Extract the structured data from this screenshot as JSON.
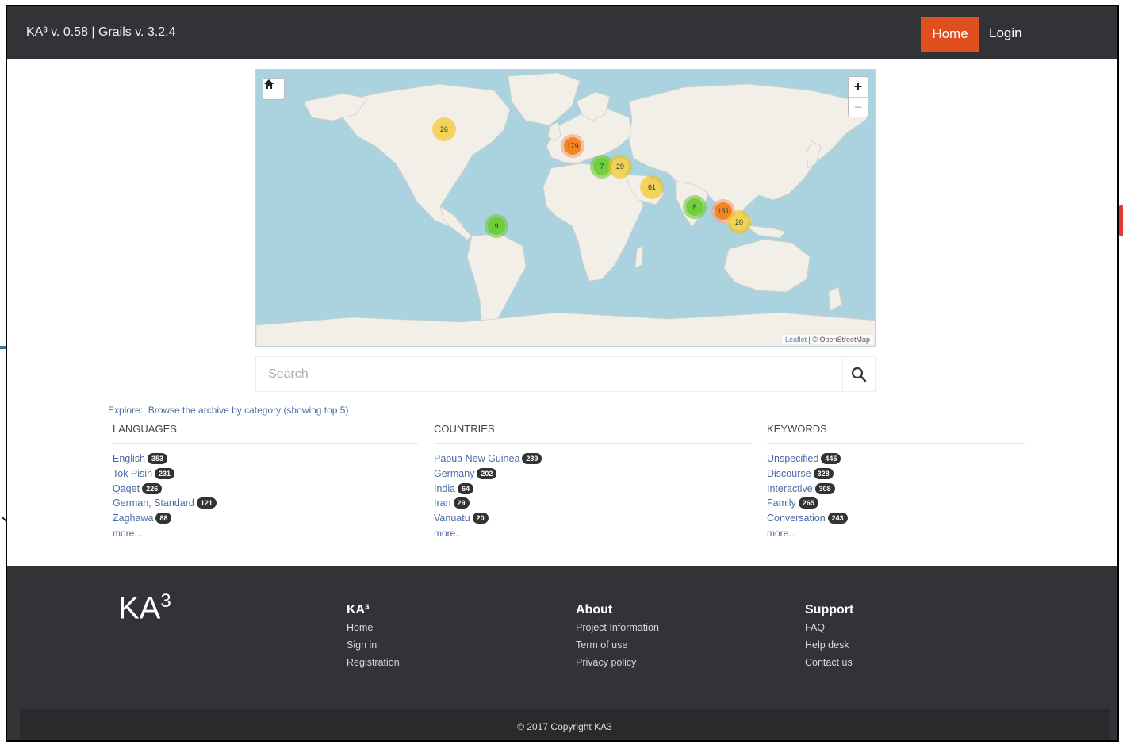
{
  "navbar": {
    "brand": "KA³ v. 0.58 | Grails v. 3.2.4",
    "home_label": "Home",
    "login_label": "Login",
    "accent_color": "#e0501f"
  },
  "map": {
    "home_icon": "home-icon",
    "zoom_in": "+",
    "zoom_out": "−",
    "attribution_leaflet": "Leaflet",
    "attribution_rest": " | © OpenStreetMap",
    "clusters": [
      {
        "label": "26",
        "level": "medium"
      },
      {
        "label": "179",
        "level": "large"
      },
      {
        "label": "7",
        "level": "small"
      },
      {
        "label": "29",
        "level": "medium"
      },
      {
        "label": "61",
        "level": "medium"
      },
      {
        "label": "9",
        "level": "small"
      },
      {
        "label": "8",
        "level": "small"
      },
      {
        "label": "151",
        "level": "large"
      },
      {
        "label": "20",
        "level": "medium"
      }
    ]
  },
  "search": {
    "placeholder": "Search",
    "icon": "search-icon"
  },
  "explore": {
    "text": "Explore:: Browse the archive by category (showing top 5)",
    "languages": {
      "heading": "LANGUAGES",
      "items": [
        {
          "label": "English",
          "count": "353"
        },
        {
          "label": "Tok Pisin",
          "count": "231"
        },
        {
          "label": "Qaqet",
          "count": "226"
        },
        {
          "label": "German, Standard",
          "count": "121"
        },
        {
          "label": "Zaghawa",
          "count": "88"
        }
      ],
      "more": "more..."
    },
    "countries": {
      "heading": "COUNTRIES",
      "items": [
        {
          "label": "Papua New Guinea",
          "count": "239"
        },
        {
          "label": "Germany",
          "count": "202"
        },
        {
          "label": "India",
          "count": "64"
        },
        {
          "label": "Iran",
          "count": "29"
        },
        {
          "label": "Vanuatu",
          "count": "20"
        }
      ],
      "more": "more..."
    },
    "keywords": {
      "heading": "KEYWORDS",
      "items": [
        {
          "label": "Unspecified",
          "count": "445"
        },
        {
          "label": "Discourse",
          "count": "328"
        },
        {
          "label": "Interactive",
          "count": "308"
        },
        {
          "label": "Family",
          "count": "265"
        },
        {
          "label": "Conversation",
          "count": "243"
        }
      ],
      "more": "more..."
    }
  },
  "footer": {
    "logo": "KA",
    "logo_sup": "3",
    "ka": {
      "title": "KA³",
      "links": [
        "Home",
        "Sign in",
        "Registration"
      ]
    },
    "about": {
      "title": "About",
      "links": [
        "Project Information",
        "Term of use",
        "Privacy policy"
      ]
    },
    "support": {
      "title": "Support",
      "links": [
        "FAQ",
        "Help desk",
        "Contact us"
      ]
    },
    "copyright": "© 2017 Copyright KA3"
  }
}
